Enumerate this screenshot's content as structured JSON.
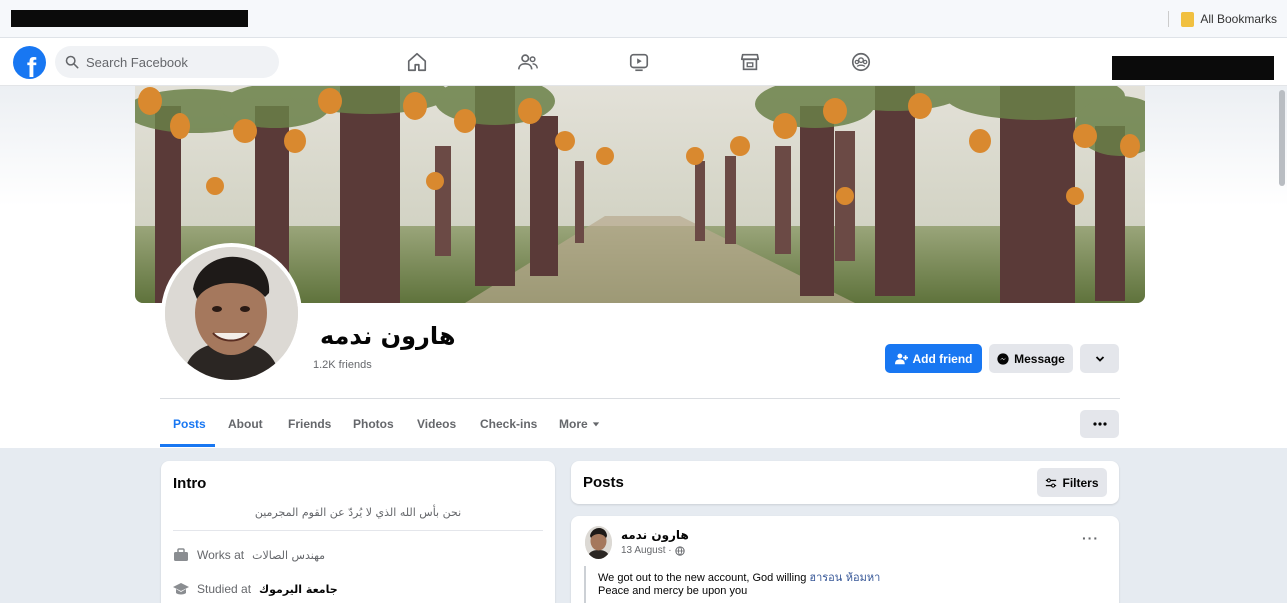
{
  "browser": {
    "bookmarks_label": "All Bookmarks"
  },
  "nav": {
    "logo": "f",
    "search_placeholder": "Search Facebook",
    "icons": [
      "home-icon",
      "friends-icon",
      "watch-icon",
      "marketplace-icon",
      "groups-icon"
    ]
  },
  "profile": {
    "name": "هارون ندمه",
    "friends": "1.2K friends",
    "add_friend_label": "Add friend",
    "message_label": "Message"
  },
  "tabs": [
    {
      "label": "Posts",
      "active": true
    },
    {
      "label": "About"
    },
    {
      "label": "Friends"
    },
    {
      "label": "Photos"
    },
    {
      "label": "Videos"
    },
    {
      "label": "Check-ins"
    },
    {
      "label": "More"
    }
  ],
  "intro": {
    "title": "Intro",
    "bio": "نحن بأس الله الذي لا يُردّ عن القوم المجرمين",
    "work_prefix": "Works at",
    "work_value": "مهندس الصالات",
    "study_prefix": "Studied at",
    "study_value": "جامعة اليرموك"
  },
  "posts": {
    "title": "Posts",
    "filters_label": "Filters",
    "items": [
      {
        "author": "هارون ندمه",
        "date": "13 August ·",
        "line1": "We got out to the new account, God willing",
        "line1_link": "ฮารอน ห้อมหา",
        "line2": "Peace and mercy be upon you"
      }
    ]
  },
  "colors": {
    "brand": "#1877f2",
    "secondary_button": "#e4e6eb"
  }
}
